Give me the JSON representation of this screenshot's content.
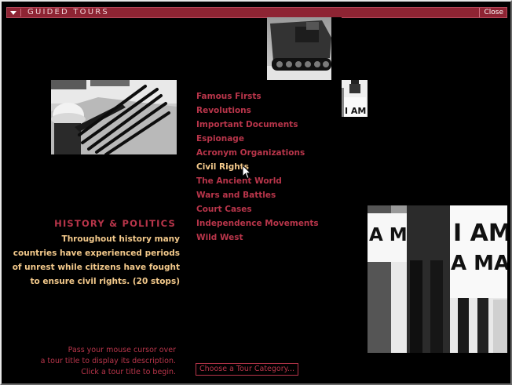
{
  "window": {
    "title": "GUIDED TOURS",
    "close_label": "Close"
  },
  "tours": [
    {
      "label": "Famous Firsts"
    },
    {
      "label": "Revolutions"
    },
    {
      "label": "Important Documents"
    },
    {
      "label": "Espionage"
    },
    {
      "label": "Acronym Organizations"
    },
    {
      "label": "Civil Rights",
      "active": true
    },
    {
      "label": "The Ancient World"
    },
    {
      "label": "Wars and Battles"
    },
    {
      "label": "Court Cases"
    },
    {
      "label": "Independence Movements"
    },
    {
      "label": "Wild West"
    }
  ],
  "category": {
    "heading": "HISTORY & POLITICS",
    "description_lines": [
      "Throughout history many",
      "countries have experienced periods",
      "of unrest while citizens have fought",
      "to ensure civil rights. (20 stops)"
    ]
  },
  "instructions": {
    "lines": [
      "Pass your mouse cursor over",
      "a tour title to display its description.",
      "Click a tour title to begin."
    ]
  },
  "choose_button": {
    "label": "Choose a Tour Category..."
  },
  "photo_signs": {
    "small": "I AM",
    "large_left": "A M",
    "large_right_1": "I AM",
    "large_right_2": "A MAN"
  },
  "colors": {
    "accent_red": "#b8354a",
    "highlight_gold": "#f3c98b",
    "titlebar": "#8e2433",
    "background": "#000000"
  }
}
